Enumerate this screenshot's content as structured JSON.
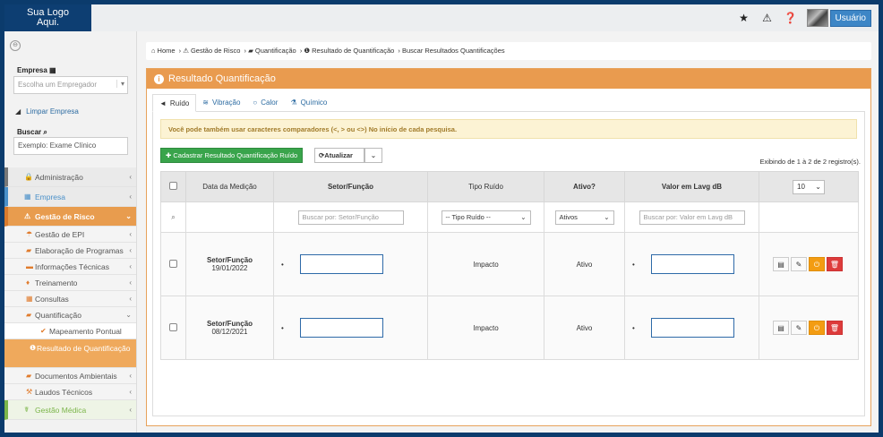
{
  "header": {
    "logo_line1": "Sua Logo",
    "logo_line2": "Aqui.",
    "user_label": "Usuário",
    "icons": [
      "star-icon",
      "warning-icon",
      "help-icon"
    ]
  },
  "sidebar": {
    "empresa_label": "Empresa",
    "empresa_placeholder": "Escolha um Empregador",
    "limpar_label": "Limpar Empresa",
    "buscar_label": "Buscar",
    "buscar_placeholder": "Exemplo: Exame Clínico",
    "menu": {
      "administracao": "Administração",
      "empresa": "Empresa",
      "gestao_risco": "Gestão de Risco",
      "gestao_epi": "Gestão de EPI",
      "elaboracao": "Elaboração de Programas",
      "informacoes": "Informações Técnicas",
      "treinamento": "Treinamento",
      "consultas": "Consultas",
      "quantificacao": "Quantificação",
      "mapeamento": "Mapeamento Pontual",
      "resultado": "Resultado de Quantificação",
      "documentos": "Documentos Ambientais",
      "laudos": "Laudos Técnicos",
      "gestao_medica": "Gestão Médica"
    }
  },
  "breadcrumb": [
    "Home",
    "Gestão de Risco",
    "Quantificação",
    "Resultado de Quantificação",
    "Buscar Resultados Quantificações"
  ],
  "panel": {
    "title": "Resultado Quantificação",
    "tabs": [
      "Ruído",
      "Vibração",
      "Calor",
      "Químico"
    ],
    "alert": "Você pode também usar caracteres comparadores (<, > ou <>) No início de cada pesquisa.",
    "add_button": "Cadastrar Resultado Quantificação Ruído",
    "update_button": "Atualizar",
    "showing": "Exibindo de 1 à 2 de 2 registro(s).",
    "page_size": "10"
  },
  "table": {
    "headers": [
      "Data da Medição",
      "Setor/Função",
      "Tipo Ruído",
      "Ativo?",
      "Valor em Lavg dB"
    ],
    "filters": {
      "setor_placeholder": "Buscar por: Setor/Função",
      "tipo": "-- Tipo Ruído --",
      "ativo": "Ativos",
      "valor_placeholder": "Buscar por: Valor em Lavg dB"
    },
    "rows": [
      {
        "label": "Setor/Função",
        "date": "19/01/2022",
        "tipo": "Impacto",
        "ativo": "Ativo"
      },
      {
        "label": "Setor/Função",
        "date": "08/12/2021",
        "tipo": "Impacto",
        "ativo": "Ativo"
      }
    ]
  }
}
